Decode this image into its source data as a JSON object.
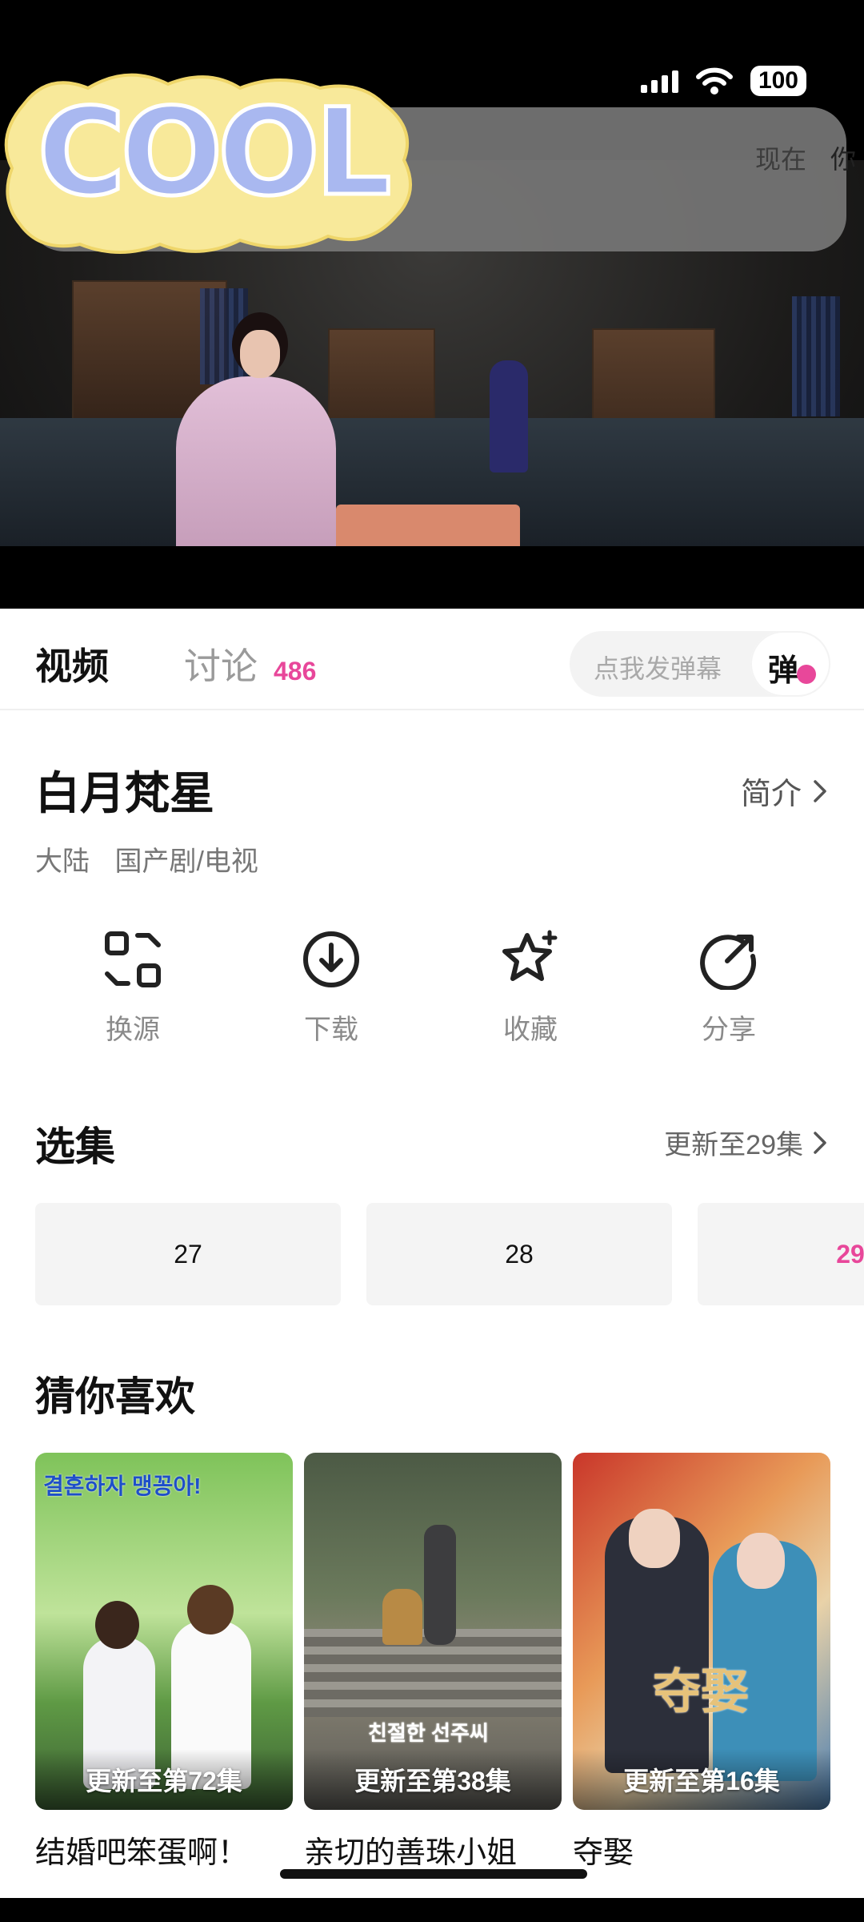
{
  "status_bar": {
    "battery": "100"
  },
  "notification": {
    "time": "现在",
    "trailing": "你"
  },
  "sticker": {
    "text": "COOL"
  },
  "tabs": {
    "video": "视频",
    "discuss": "讨论",
    "discuss_count": "486",
    "danmu_placeholder": "点我发弹幕",
    "danmu_button": "弹"
  },
  "show": {
    "title": "白月梵星",
    "intro_link": "简介",
    "region": "大陆",
    "category": "国产剧/电视"
  },
  "actions": [
    {
      "label": "换源",
      "icon": "swap-source-icon"
    },
    {
      "label": "下载",
      "icon": "download-icon"
    },
    {
      "label": "收藏",
      "icon": "star-icon"
    },
    {
      "label": "分享",
      "icon": "share-icon"
    }
  ],
  "episodes": {
    "title": "选集",
    "update_status": "更新至29集",
    "items": [
      "27",
      "28",
      "29"
    ],
    "current": "29"
  },
  "recommend": {
    "title": "猜你喜欢",
    "items": [
      {
        "name": "结婚吧笨蛋啊！",
        "badge": "更新至第72集",
        "poster_text": "결혼하자 맹꽁아!"
      },
      {
        "name": "亲切的善珠小姐",
        "badge": "更新至第38集",
        "poster_text": "친절한 선주씨"
      },
      {
        "name": "夺娶",
        "badge": "更新至第16集",
        "poster_text": "夺娶"
      }
    ]
  },
  "colors": {
    "accent": "#e8479a",
    "background": "#ffffff",
    "muted_text": "#8a8a8a"
  }
}
